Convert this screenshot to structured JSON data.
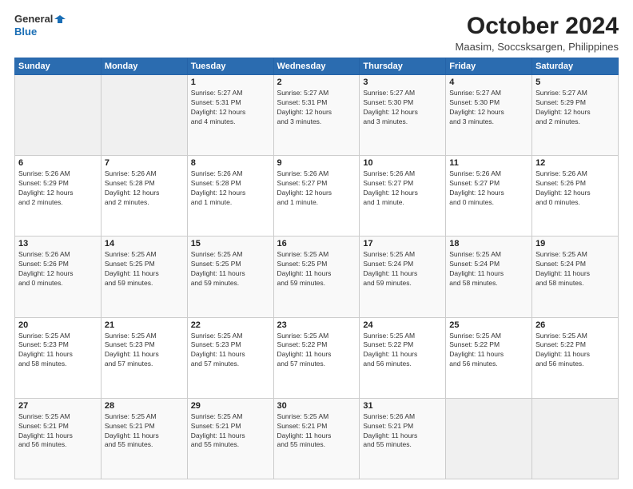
{
  "header": {
    "logo_line1": "General",
    "logo_line2": "Blue",
    "month": "October 2024",
    "location": "Maasim, Soccsksargen, Philippines"
  },
  "days_of_week": [
    "Sunday",
    "Monday",
    "Tuesday",
    "Wednesday",
    "Thursday",
    "Friday",
    "Saturday"
  ],
  "weeks": [
    [
      {
        "day": "",
        "info": ""
      },
      {
        "day": "",
        "info": ""
      },
      {
        "day": "1",
        "info": "Sunrise: 5:27 AM\nSunset: 5:31 PM\nDaylight: 12 hours\nand 4 minutes."
      },
      {
        "day": "2",
        "info": "Sunrise: 5:27 AM\nSunset: 5:31 PM\nDaylight: 12 hours\nand 3 minutes."
      },
      {
        "day": "3",
        "info": "Sunrise: 5:27 AM\nSunset: 5:30 PM\nDaylight: 12 hours\nand 3 minutes."
      },
      {
        "day": "4",
        "info": "Sunrise: 5:27 AM\nSunset: 5:30 PM\nDaylight: 12 hours\nand 3 minutes."
      },
      {
        "day": "5",
        "info": "Sunrise: 5:27 AM\nSunset: 5:29 PM\nDaylight: 12 hours\nand 2 minutes."
      }
    ],
    [
      {
        "day": "6",
        "info": "Sunrise: 5:26 AM\nSunset: 5:29 PM\nDaylight: 12 hours\nand 2 minutes."
      },
      {
        "day": "7",
        "info": "Sunrise: 5:26 AM\nSunset: 5:28 PM\nDaylight: 12 hours\nand 2 minutes."
      },
      {
        "day": "8",
        "info": "Sunrise: 5:26 AM\nSunset: 5:28 PM\nDaylight: 12 hours\nand 1 minute."
      },
      {
        "day": "9",
        "info": "Sunrise: 5:26 AM\nSunset: 5:27 PM\nDaylight: 12 hours\nand 1 minute."
      },
      {
        "day": "10",
        "info": "Sunrise: 5:26 AM\nSunset: 5:27 PM\nDaylight: 12 hours\nand 1 minute."
      },
      {
        "day": "11",
        "info": "Sunrise: 5:26 AM\nSunset: 5:27 PM\nDaylight: 12 hours\nand 0 minutes."
      },
      {
        "day": "12",
        "info": "Sunrise: 5:26 AM\nSunset: 5:26 PM\nDaylight: 12 hours\nand 0 minutes."
      }
    ],
    [
      {
        "day": "13",
        "info": "Sunrise: 5:26 AM\nSunset: 5:26 PM\nDaylight: 12 hours\nand 0 minutes."
      },
      {
        "day": "14",
        "info": "Sunrise: 5:25 AM\nSunset: 5:25 PM\nDaylight: 11 hours\nand 59 minutes."
      },
      {
        "day": "15",
        "info": "Sunrise: 5:25 AM\nSunset: 5:25 PM\nDaylight: 11 hours\nand 59 minutes."
      },
      {
        "day": "16",
        "info": "Sunrise: 5:25 AM\nSunset: 5:25 PM\nDaylight: 11 hours\nand 59 minutes."
      },
      {
        "day": "17",
        "info": "Sunrise: 5:25 AM\nSunset: 5:24 PM\nDaylight: 11 hours\nand 59 minutes."
      },
      {
        "day": "18",
        "info": "Sunrise: 5:25 AM\nSunset: 5:24 PM\nDaylight: 11 hours\nand 58 minutes."
      },
      {
        "day": "19",
        "info": "Sunrise: 5:25 AM\nSunset: 5:24 PM\nDaylight: 11 hours\nand 58 minutes."
      }
    ],
    [
      {
        "day": "20",
        "info": "Sunrise: 5:25 AM\nSunset: 5:23 PM\nDaylight: 11 hours\nand 58 minutes."
      },
      {
        "day": "21",
        "info": "Sunrise: 5:25 AM\nSunset: 5:23 PM\nDaylight: 11 hours\nand 57 minutes."
      },
      {
        "day": "22",
        "info": "Sunrise: 5:25 AM\nSunset: 5:23 PM\nDaylight: 11 hours\nand 57 minutes."
      },
      {
        "day": "23",
        "info": "Sunrise: 5:25 AM\nSunset: 5:22 PM\nDaylight: 11 hours\nand 57 minutes."
      },
      {
        "day": "24",
        "info": "Sunrise: 5:25 AM\nSunset: 5:22 PM\nDaylight: 11 hours\nand 56 minutes."
      },
      {
        "day": "25",
        "info": "Sunrise: 5:25 AM\nSunset: 5:22 PM\nDaylight: 11 hours\nand 56 minutes."
      },
      {
        "day": "26",
        "info": "Sunrise: 5:25 AM\nSunset: 5:22 PM\nDaylight: 11 hours\nand 56 minutes."
      }
    ],
    [
      {
        "day": "27",
        "info": "Sunrise: 5:25 AM\nSunset: 5:21 PM\nDaylight: 11 hours\nand 56 minutes."
      },
      {
        "day": "28",
        "info": "Sunrise: 5:25 AM\nSunset: 5:21 PM\nDaylight: 11 hours\nand 55 minutes."
      },
      {
        "day": "29",
        "info": "Sunrise: 5:25 AM\nSunset: 5:21 PM\nDaylight: 11 hours\nand 55 minutes."
      },
      {
        "day": "30",
        "info": "Sunrise: 5:25 AM\nSunset: 5:21 PM\nDaylight: 11 hours\nand 55 minutes."
      },
      {
        "day": "31",
        "info": "Sunrise: 5:26 AM\nSunset: 5:21 PM\nDaylight: 11 hours\nand 55 minutes."
      },
      {
        "day": "",
        "info": ""
      },
      {
        "day": "",
        "info": ""
      }
    ]
  ]
}
